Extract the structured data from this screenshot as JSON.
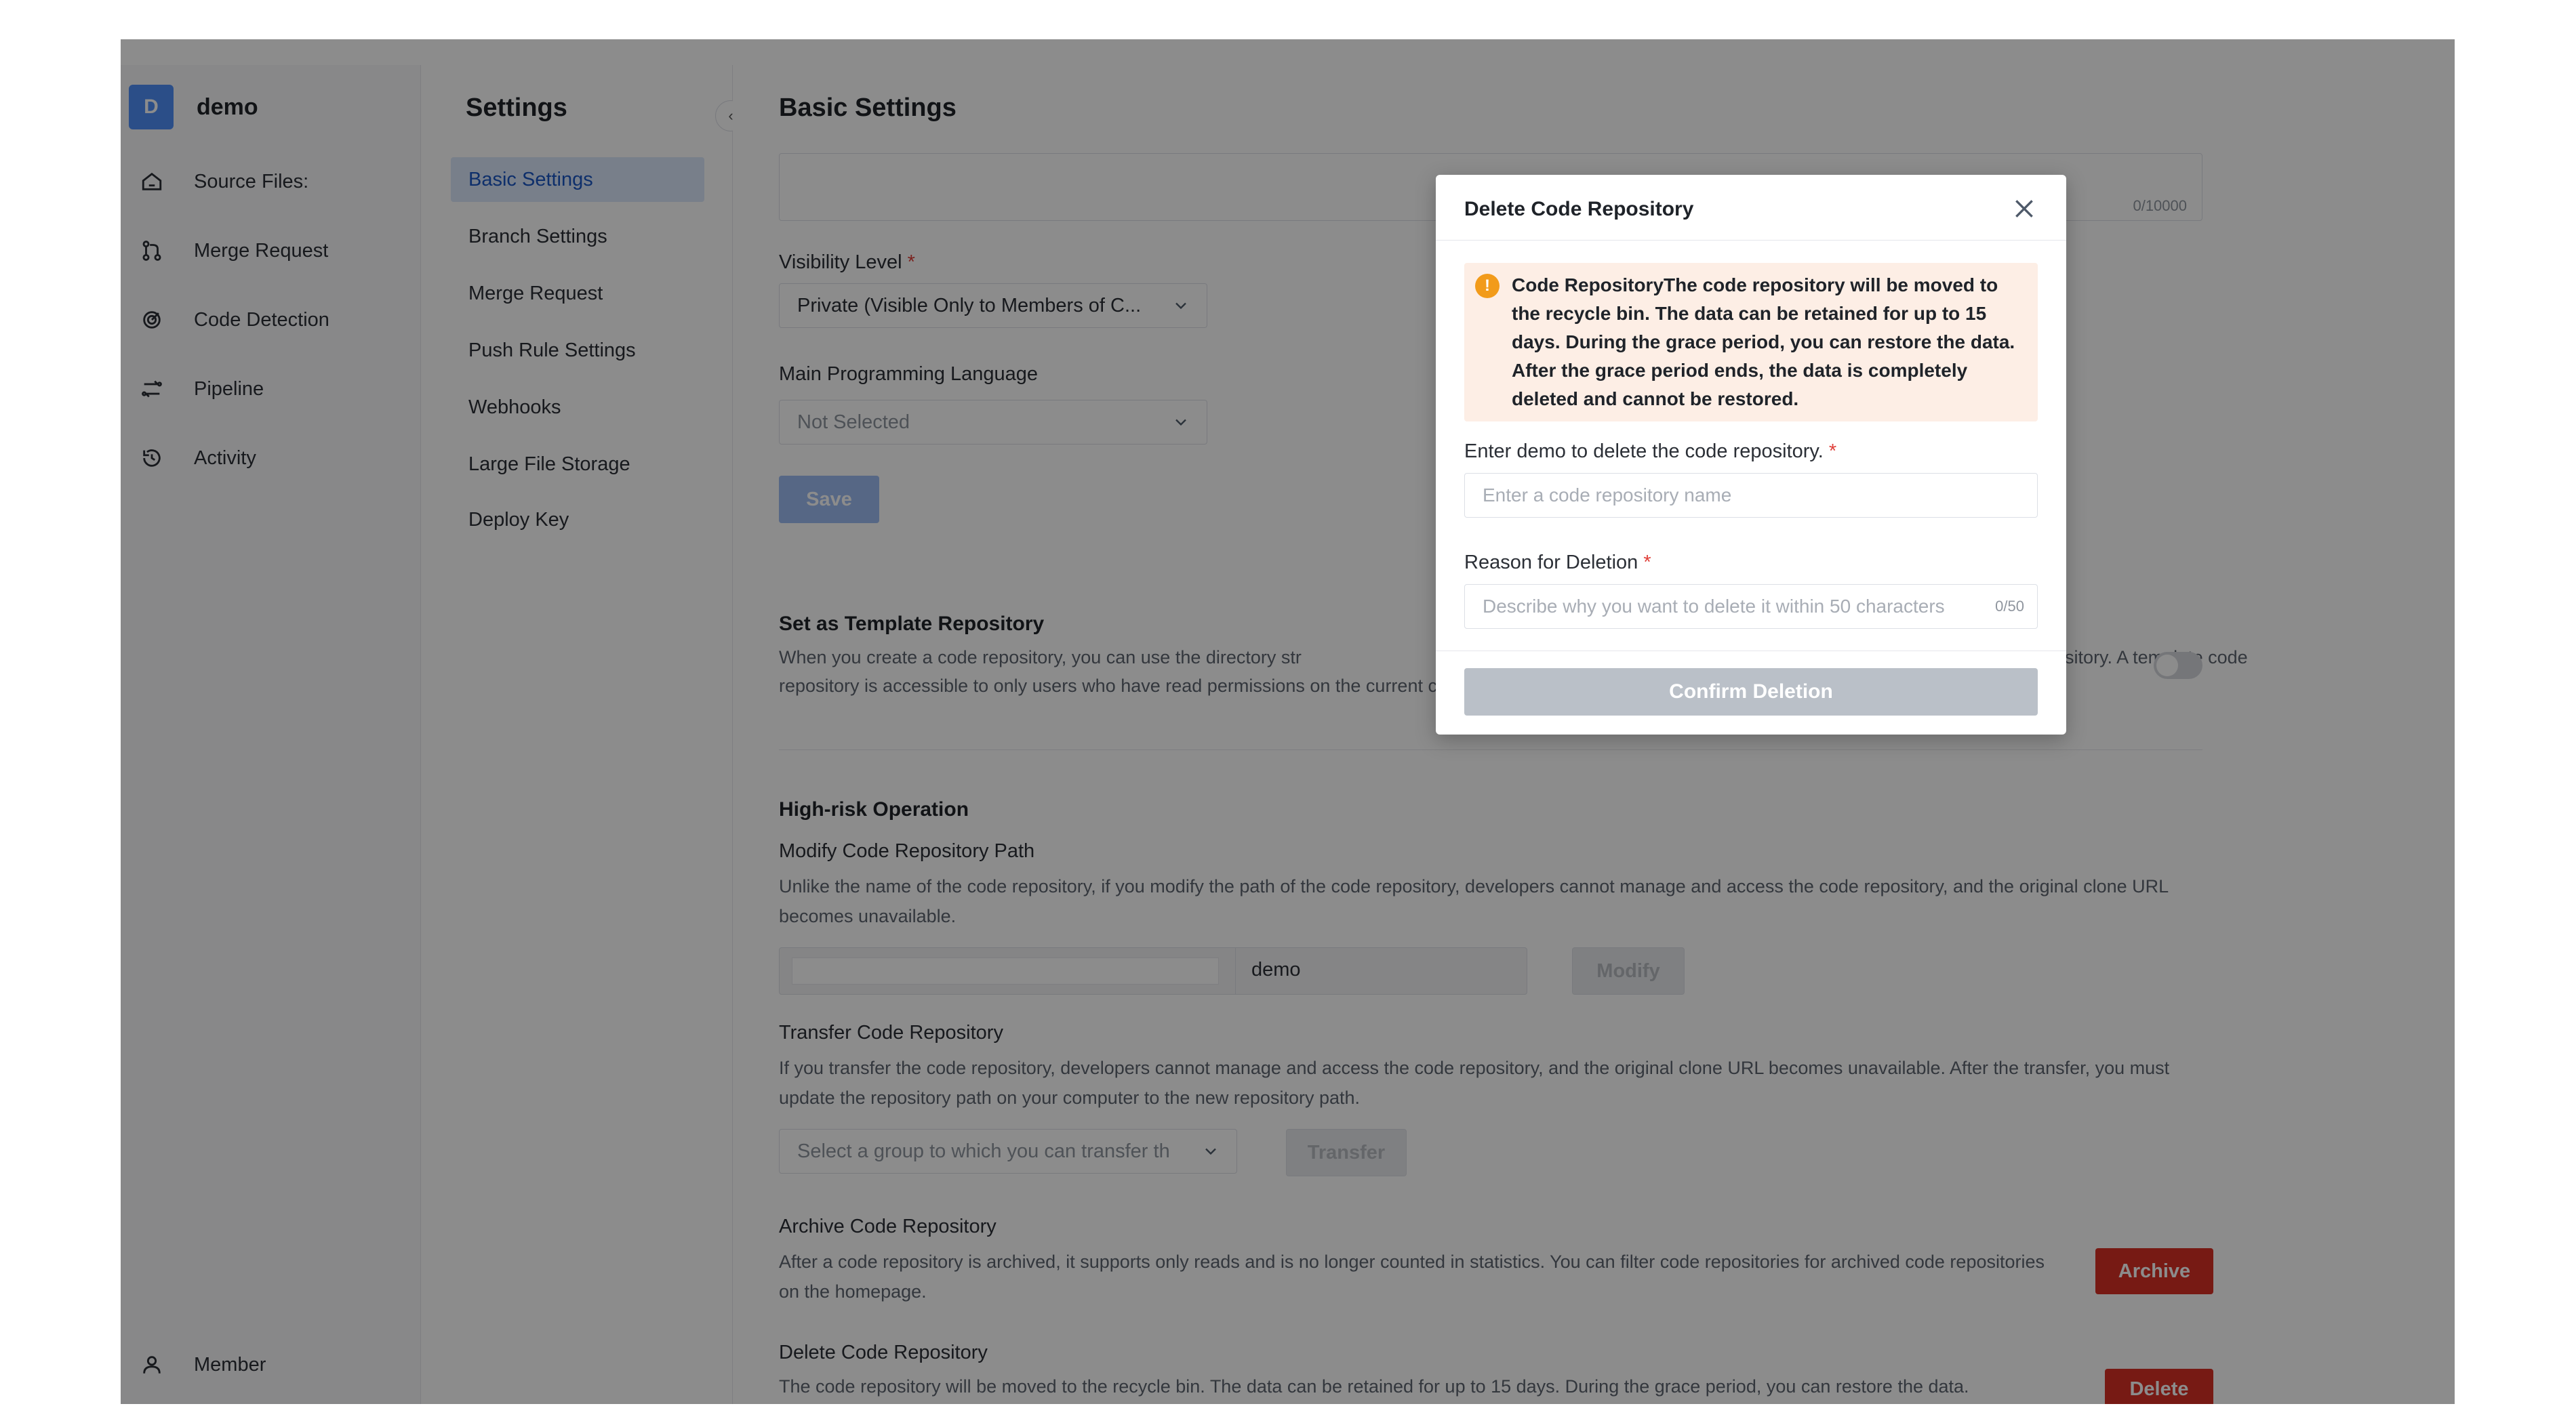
{
  "project": {
    "avatar_letter": "D",
    "name": "demo"
  },
  "nav": {
    "items": [
      {
        "label": "Source Files:",
        "icon": "home-icon"
      },
      {
        "label": "Merge Request",
        "icon": "merge-icon"
      },
      {
        "label": "Code Detection",
        "icon": "scan-icon"
      },
      {
        "label": "Pipeline",
        "icon": "pipeline-icon"
      },
      {
        "label": "Activity",
        "icon": "history-icon"
      }
    ],
    "member": {
      "label": "Member",
      "icon": "user-icon"
    }
  },
  "settings": {
    "title": "Settings",
    "collapse_icon": "chevron-left-icon",
    "items": [
      {
        "label": "Basic Settings",
        "active": true
      },
      {
        "label": "Branch Settings"
      },
      {
        "label": "Merge Request"
      },
      {
        "label": "Push Rule Settings"
      },
      {
        "label": "Webhooks"
      },
      {
        "label": "Large File Storage"
      },
      {
        "label": "Deploy Key"
      }
    ]
  },
  "main": {
    "title": "Basic Settings",
    "description_counter": "0/10000",
    "visibility": {
      "label": "Visibility Level",
      "required_mark": "*",
      "value": "Private (Visible Only to Members of C..."
    },
    "language": {
      "label": "Main Programming Language",
      "value": "Not Selected"
    },
    "save_label": "Save",
    "template": {
      "title": "Set as Template Repository",
      "desc_line1_left": "When you create a code repository, you can use the directory str",
      "desc_line1_right": "epository. A template code",
      "desc_line2": "repository is accessible to only users who have read permissions on the current code repository."
    },
    "high_risk": {
      "title": "High-risk Operation",
      "modify": {
        "title": "Modify Code Repository Path",
        "desc": "Unlike the name of the code repository, if you modify the path of the code repository, developers cannot manage and access the code repository, and the original clone URL becomes unavailable.",
        "path_value": "demo",
        "button": "Modify"
      },
      "transfer": {
        "title": "Transfer Code Repository",
        "desc": "If you transfer the code repository, developers cannot manage and access the code repository, and the original clone URL becomes unavailable. After the transfer, you must update the repository path on your computer to the new repository path.",
        "placeholder": "Select a group to which you can transfer th",
        "button": "Transfer"
      },
      "archive": {
        "title": "Archive Code Repository",
        "desc": "After a code repository is archived, it supports only reads and is no longer counted in statistics. You can filter code repositories for archived code repositories on the homepage.",
        "button": "Archive"
      },
      "delete": {
        "title": "Delete Code Repository",
        "desc": "The code repository will be moved to the recycle bin. The data can be retained for up to 15 days. During the grace period, you can restore the data.",
        "button": "Delete"
      }
    }
  },
  "modal": {
    "title": "Delete Code Repository",
    "close_icon": "close-icon",
    "alert_icon": "warning-icon",
    "alert_text": "Code RepositoryThe code repository will be moved to the recycle bin. The data can be retained for up to 15 days. During the grace period, you can restore the data. After the grace period ends, the data is completely deleted and cannot be restored.",
    "name_label": "Enter demo to delete the code repository.",
    "required_mark": "*",
    "name_placeholder": "Enter a code repository name",
    "reason_label": "Reason for Deletion",
    "reason_placeholder": "Describe why you want to delete it within 50 characters",
    "reason_counter": "0/50",
    "confirm_label": "Confirm Deletion"
  }
}
